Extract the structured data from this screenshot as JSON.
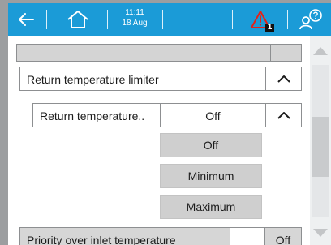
{
  "header": {
    "time": "11:11",
    "date": "18 Aug",
    "alarm_count": "1",
    "icons": [
      "back-arrow-icon",
      "home-icon",
      "warning-icon",
      "user-help-icon"
    ]
  },
  "settings": {
    "row1_label": "Return temperature limiter",
    "row2_label": "Return temperature..",
    "row2_value": "Off",
    "options": [
      "Off",
      "Minimum",
      "Maximum"
    ],
    "row3_label": "Priority over inlet temperature",
    "row3_value": "Off"
  },
  "colors": {
    "header": "#1b9bd7",
    "warning": "#e2231a",
    "selected_background": "#cfcfcf"
  }
}
